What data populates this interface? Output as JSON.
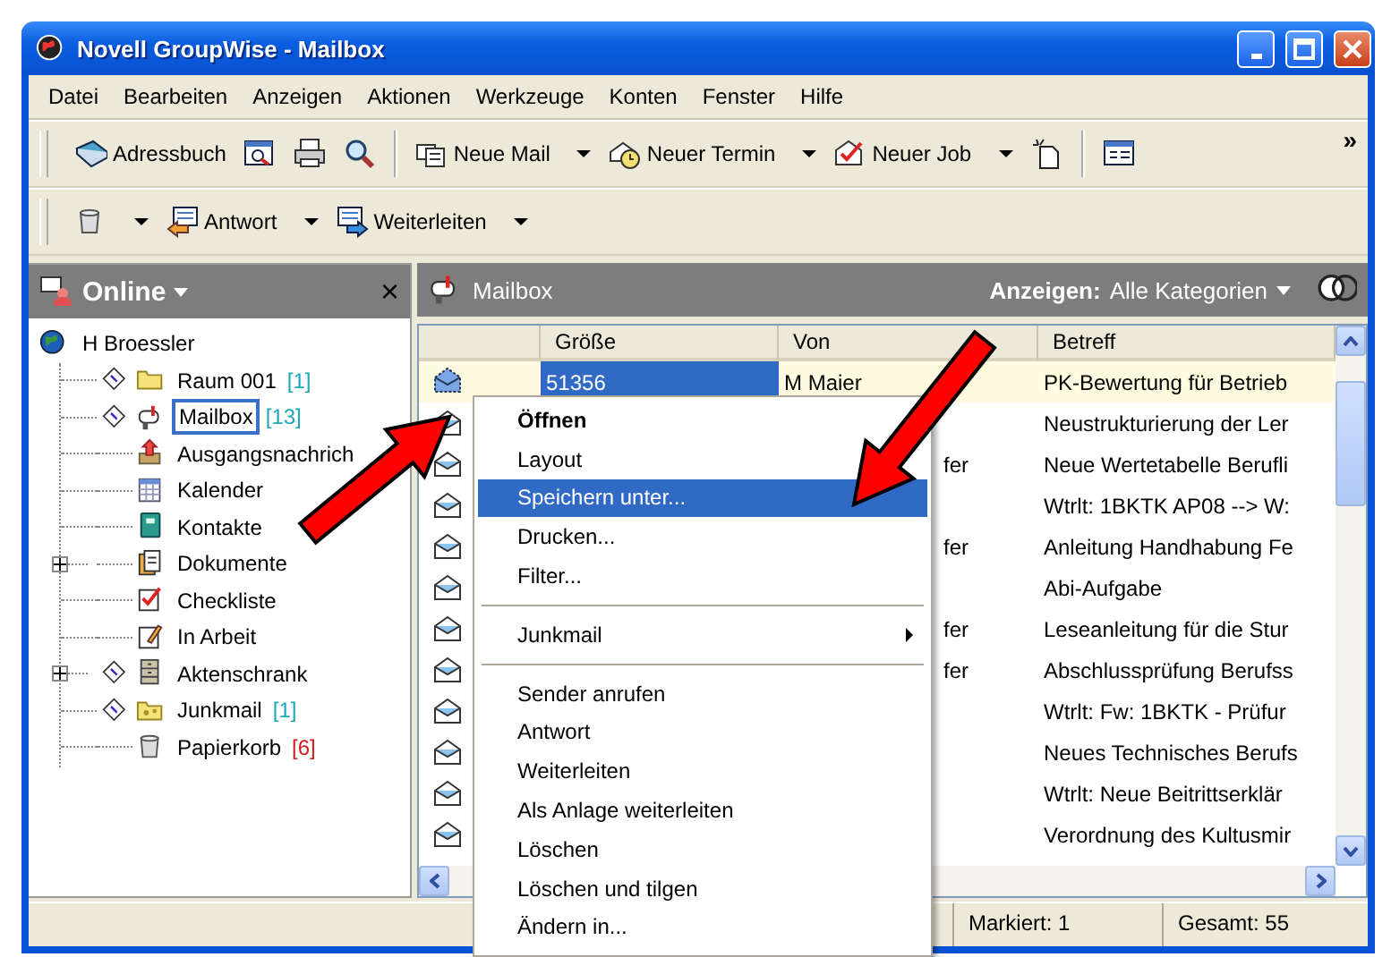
{
  "window": {
    "title": "Novell GroupWise - Mailbox"
  },
  "menu_bar": [
    "Datei",
    "Bearbeiten",
    "Anzeigen",
    "Aktionen",
    "Werkzeuge",
    "Konten",
    "Fenster",
    "Hilfe"
  ],
  "toolbar_1": [
    {
      "kind": "button",
      "label": "Adressbuch",
      "dropdown": false
    },
    {
      "kind": "icon-button",
      "dropdown": false
    },
    {
      "kind": "icon-button",
      "dropdown": false
    },
    {
      "kind": "icon-button",
      "dropdown": false
    },
    {
      "kind": "separator"
    },
    {
      "kind": "button",
      "label": "Neue Mail",
      "dropdown": true
    },
    {
      "kind": "button",
      "label": "Neuer Termin",
      "dropdown": true
    },
    {
      "kind": "button",
      "label": "Neuer Job",
      "dropdown": true
    },
    {
      "kind": "icon-button",
      "dropdown": false
    },
    {
      "kind": "separator"
    },
    {
      "kind": "icon-button",
      "dropdown": false
    },
    {
      "kind": "overflow",
      "label": "»"
    }
  ],
  "toolbar_2": [
    {
      "kind": "icon-button",
      "dropdown": true
    },
    {
      "kind": "button",
      "label": "Antwort",
      "dropdown": true
    },
    {
      "kind": "button",
      "label": "Weiterleiten",
      "dropdown": true
    }
  ],
  "folder_pane": {
    "title": "Online",
    "close": "×",
    "tree": {
      "label": "H Broessler",
      "selected": false,
      "children": [
        {
          "label": "Raum 001",
          "count": "[1]",
          "color": "#1fa8b8",
          "shared": true,
          "expandable": false,
          "selected": false
        },
        {
          "label": "Mailbox",
          "count": "[13]",
          "color": "#1fa8b8",
          "shared": true,
          "expandable": false,
          "selected": true
        },
        {
          "label": "Ausgangsnachrich",
          "shared": false,
          "expandable": false,
          "selected": false
        },
        {
          "label": "Kalender",
          "shared": false,
          "expandable": false,
          "selected": false
        },
        {
          "label": "Kontakte",
          "shared": false,
          "expandable": false,
          "selected": false
        },
        {
          "label": "Dokumente",
          "shared": false,
          "expandable": true,
          "selected": false
        },
        {
          "label": "Checkliste",
          "shared": false,
          "expandable": false,
          "selected": false
        },
        {
          "label": "In Arbeit",
          "shared": false,
          "expandable": false,
          "selected": false
        },
        {
          "label": "Aktenschrank",
          "shared": true,
          "expandable": true,
          "selected": false
        },
        {
          "label": "Junkmail",
          "count": "[1]",
          "color": "#1fa8b8",
          "shared": true,
          "expandable": false,
          "selected": false
        },
        {
          "label": "Papierkorb",
          "count": "[6]",
          "color": "#d02020",
          "shared": false,
          "expandable": false,
          "selected": false
        }
      ]
    }
  },
  "mailbox_pane": {
    "title": "Mailbox",
    "filter_label": "Anzeigen:",
    "filter_value": "Alle Kategorien",
    "columns": [
      "Größe",
      "Von",
      "Betreff"
    ],
    "rows": [
      {
        "size": "51356",
        "from": "M Maier",
        "subject": "PK-Bewertung für Betrieb",
        "opened": false,
        "selected": true
      },
      {
        "subject": "Neustrukturierung der Ler",
        "opened": true,
        "selected": false
      },
      {
        "from": "fer",
        "subject": "Neue Wertetabelle Berufli",
        "opened": true,
        "selected": false
      },
      {
        "subject": "Wtrlt: 1BKTK AP08 --> W:",
        "opened": true,
        "selected": false
      },
      {
        "from": "fer",
        "subject": "Anleitung Handhabung Fe",
        "opened": true,
        "selected": false
      },
      {
        "subject": "Abi-Aufgabe",
        "opened": true,
        "selected": false
      },
      {
        "from": "fer",
        "subject": "Leseanleitung für die Stur",
        "opened": true,
        "selected": false
      },
      {
        "from": "fer",
        "subject": "Abschlussprüfung Berufss",
        "opened": true,
        "selected": false
      },
      {
        "subject": "Wtrlt: Fw: 1BKTK - Prüfur",
        "opened": true,
        "selected": false
      },
      {
        "subject": "Neues Technisches Berufs",
        "opened": true,
        "selected": false
      },
      {
        "subject": "Wtrlt: Neue Beitrittserklär",
        "opened": true,
        "selected": false
      },
      {
        "subject": "Verordnung des Kultusmir",
        "opened": true,
        "selected": false
      }
    ]
  },
  "status_bar": {
    "marked": "Markiert: 1",
    "total": "Gesamt: 55"
  },
  "context_menu": [
    {
      "kind": "item",
      "label": "Öffnen",
      "default": true,
      "selected": false
    },
    {
      "kind": "item",
      "label": "Layout",
      "default": false,
      "selected": false
    },
    {
      "kind": "item",
      "label": "Speichern unter...",
      "default": false,
      "selected": true
    },
    {
      "kind": "item",
      "label": "Drucken...",
      "default": false,
      "selected": false
    },
    {
      "kind": "item",
      "label": "Filter...",
      "default": false,
      "selected": false
    },
    {
      "kind": "separator"
    },
    {
      "kind": "submenu",
      "label": "Junkmail",
      "default": false,
      "selected": false
    },
    {
      "kind": "separator"
    },
    {
      "kind": "item",
      "label": "Sender anrufen",
      "default": false,
      "selected": false
    },
    {
      "kind": "item",
      "label": "Antwort",
      "default": false,
      "selected": false
    },
    {
      "kind": "item",
      "label": "Weiterleiten",
      "default": false,
      "selected": false
    },
    {
      "kind": "item",
      "label": "Als Anlage weiterleiten",
      "default": false,
      "selected": false
    },
    {
      "kind": "item",
      "label": "Löschen",
      "default": false,
      "selected": false
    },
    {
      "kind": "item",
      "label": "Löschen und tilgen",
      "default": false,
      "selected": false
    },
    {
      "kind": "item",
      "label": "Ändern in...",
      "default": false,
      "selected": false
    }
  ]
}
